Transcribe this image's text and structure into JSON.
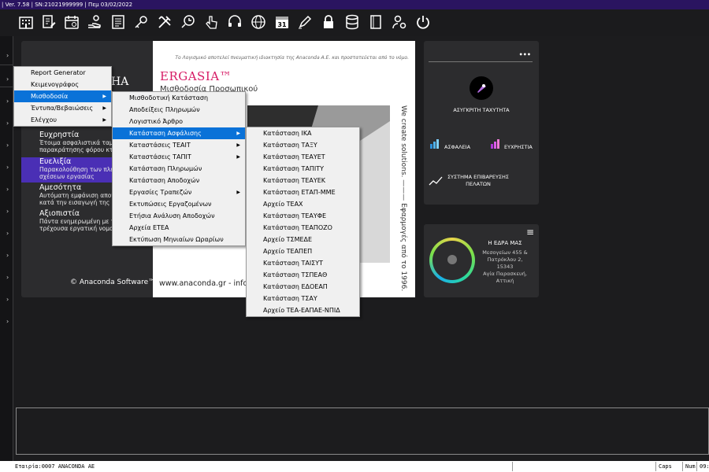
{
  "titlebar": {
    "text": "| Ver. 7.58 | SN:21021999999 | Πεμ 03/02/2022"
  },
  "toolbar": {
    "icons": [
      "building-icon",
      "document-edit-icon",
      "calendar-icon",
      "hand-coins-icon",
      "register-icon",
      "key-icon",
      "tools-icon",
      "timer-icon",
      "pointer-hand-icon",
      "headset-icon",
      "globe-icon",
      "calendar-31-icon",
      "pen-icon",
      "lock-icon",
      "database-icon",
      "notebook-icon",
      "user-settings-icon",
      "power-icon"
    ],
    "calendar_day": "31"
  },
  "left_panel": {
    "partial_brand": "HA",
    "items": [
      {
        "title": "Ευχρηστία",
        "lines": [
          "Έτοιμα ασφαλιστικά ταμ",
          "παρακράτησης φόρου κτ"
        ]
      },
      {
        "title": "Ευελιξία",
        "lines": [
          "Παρακολούθηση των πλε",
          "σχέσεων εργασίας"
        ]
      },
      {
        "title": "Αμεσότητα",
        "lines": [
          "Αυτόματη εμφάνιση αποτ",
          "κατά την εισαγωγή της κ"
        ]
      },
      {
        "title": "Αξιοπιστία",
        "lines": [
          "Πάντα ενημερωμένη με τ",
          "τρέχουσα εργατική νομο"
        ]
      }
    ],
    "copyright": "© Anaconda Software™"
  },
  "white_card": {
    "legal": "Το Λογισμικό αποτελεί πνευματική ιδιοκτησία της Anaconda A.E. και προστατεύεται από το νόμο.",
    "title": "ERGASIA™",
    "subtitle": "Μισθοδοσία Προσωπικού",
    "web": "www.anaconda.gr - info@",
    "vertical": "We create solutions.  ———  Εφαρμογές από το 1996."
  },
  "right_card_1": {
    "dots": "•••",
    "badge_label": "ΑΣΥΓΚΡΙΤΗ ΤΑΧΥΤΗΤΑ",
    "security_label": "ΑΣΦΑΛΕΙΑ",
    "usability_label": "ΕΥΧΡΗΣΤΙΑ",
    "verify_label": "ΣΥΣΤΗΜΑ ΕΠΙΒΑΡΕΥΣΗΣ ΠΕΛΑΤΩΝ"
  },
  "right_card_2": {
    "menu_icon": "≡",
    "title": "Η ΕΔΡΑ ΜΑΣ",
    "address": [
      "Μεσογείων 455 &",
      "Πατρόκλου 2,",
      "15343",
      "Αγία Παρασκευή,",
      "Αττική"
    ]
  },
  "menus": {
    "main": [
      "Report Generator",
      "Κειμενογράφος",
      "Μισθοδοσία",
      "Έντυπα/Βεβαιώσεις",
      "Ελέγχου"
    ],
    "main_selected": 2,
    "payroll": [
      "Μισθοδοτική Κατάσταση",
      "Αποδείξεις Πληρωμών",
      "Λογιστικό Άρθρο",
      "Κατάσταση Ασφάλισης",
      "Καταστάσεις ΤΕΑΙΤ",
      "Καταστάσεις ΤΑΠΙΤ",
      "Κατάσταση Πληρωμών",
      "Κατάσταση Αποδοχών",
      "Εργασίες Τραπεζών",
      "Εκτυπώσεις Εργαζομένων",
      "Ετήσια Ανάλυση Αποδοχών",
      "Αρχεία ΕΤΕΑ",
      "Εκτύπωση Μηνιαίων Ωραρίων"
    ],
    "payroll_selected": 3,
    "insurance": [
      "Κατάσταση ΙΚΑ",
      "Κατάσταση ΤΑΞΥ",
      "Κατάσταση ΤΕΑΥΕΤ",
      "Κατάσταση ΤΑΠΙΤΥ",
      "Κατάσταση ΤΕΑΥΕΚ",
      "Κατάσταση ΕΤΑΠ-ΜΜΕ",
      "Αρχείο ΤΕΑΧ",
      "Κατάσταση ΤΕΑΥΦΕ",
      "Κατάσταση ΤΕΑΠΟΖΟ",
      "Αρχείο ΤΣΜΕΔΕ",
      "Αρχείο ΤΕΑΠΕΠ",
      "Κατάσταση ΤΑΙΣΥΤ",
      "Κατάσταση ΤΣΠΕΑΘ",
      "Κατάσταση ΕΔΟΕΑΠ",
      "Κατάσταση ΤΣΑΥ",
      "Αρχείο ΤΕΑ-ΕΑΠΑΕ-ΝΠΙΔ"
    ]
  },
  "statusbar": {
    "company": "Εταιρία:0007 ANACONDA AE",
    "caps": "Caps",
    "num": "Num",
    "time": "09:"
  }
}
